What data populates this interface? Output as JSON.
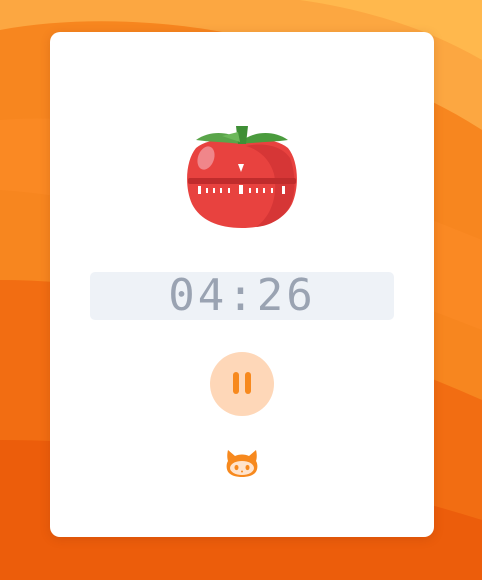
{
  "app": {
    "timer_display": "04:26"
  },
  "controls": {
    "pause_icon": "pause-icon",
    "github_icon": "octocat-icon"
  },
  "icons": {
    "tomato": "tomato-timer-icon"
  },
  "colors": {
    "background_top": "#ffb347",
    "background_bottom": "#f05a0e",
    "card": "#ffffff",
    "timer_bg": "#eef2f7",
    "timer_text": "#9aa3b2",
    "button_bg": "#fed7b8",
    "accent": "#f7891e"
  }
}
